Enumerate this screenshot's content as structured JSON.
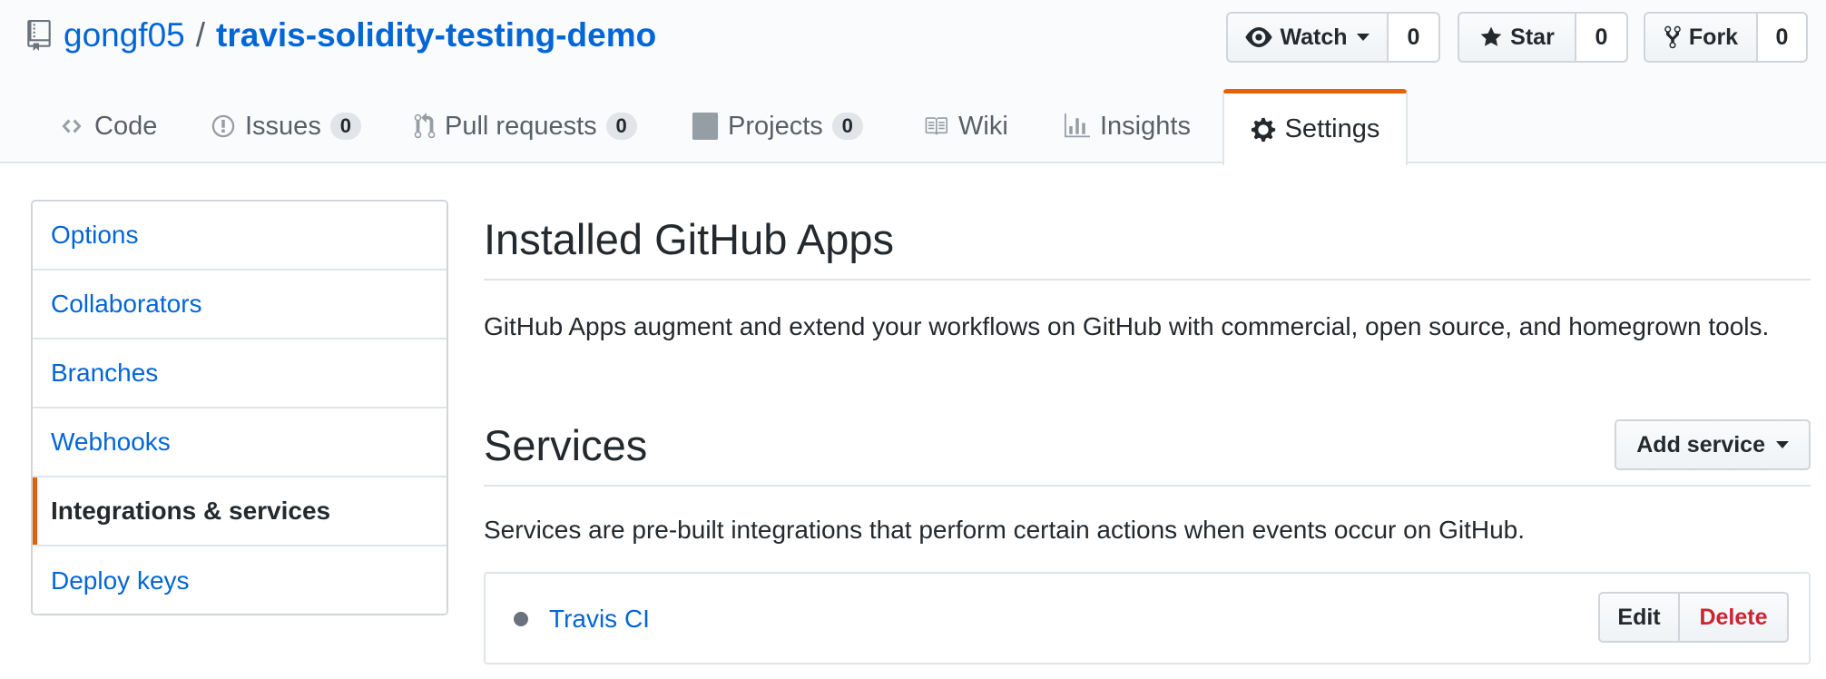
{
  "repo": {
    "owner": "gongf05",
    "separator": "/",
    "name": "travis-solidity-testing-demo"
  },
  "actions": {
    "watch": {
      "label": "Watch",
      "count": "0"
    },
    "star": {
      "label": "Star",
      "count": "0"
    },
    "fork": {
      "label": "Fork",
      "count": "0"
    }
  },
  "tabs": [
    {
      "label": "Code",
      "icon": "code-icon"
    },
    {
      "label": "Issues",
      "count": "0",
      "icon": "issue-opened-icon"
    },
    {
      "label": "Pull requests",
      "count": "0",
      "icon": "git-pull-request-icon"
    },
    {
      "label": "Projects",
      "count": "0",
      "icon": "project-icon"
    },
    {
      "label": "Wiki",
      "icon": "book-icon"
    },
    {
      "label": "Insights",
      "icon": "graph-icon"
    },
    {
      "label": "Settings",
      "icon": "gear-icon",
      "selected": true
    }
  ],
  "sidebar": {
    "items": [
      {
        "label": "Options"
      },
      {
        "label": "Collaborators"
      },
      {
        "label": "Branches"
      },
      {
        "label": "Webhooks"
      },
      {
        "label": "Integrations & services",
        "selected": true
      },
      {
        "label": "Deploy keys"
      }
    ]
  },
  "apps": {
    "title": "Installed GitHub Apps",
    "description": "GitHub Apps augment and extend your workflows on GitHub with commercial, open source, and homegrown tools."
  },
  "services": {
    "title": "Services",
    "add_label": "Add service",
    "description": "Services are pre-built integrations that perform certain actions when events occur on GitHub.",
    "items": [
      {
        "name": "Travis CI",
        "edit_label": "Edit",
        "delete_label": "Delete"
      }
    ]
  },
  "colors": {
    "link": "#0366d6",
    "accent": "#e36209",
    "danger": "#cb2431",
    "text": "#24292e",
    "muted": "#586069"
  }
}
